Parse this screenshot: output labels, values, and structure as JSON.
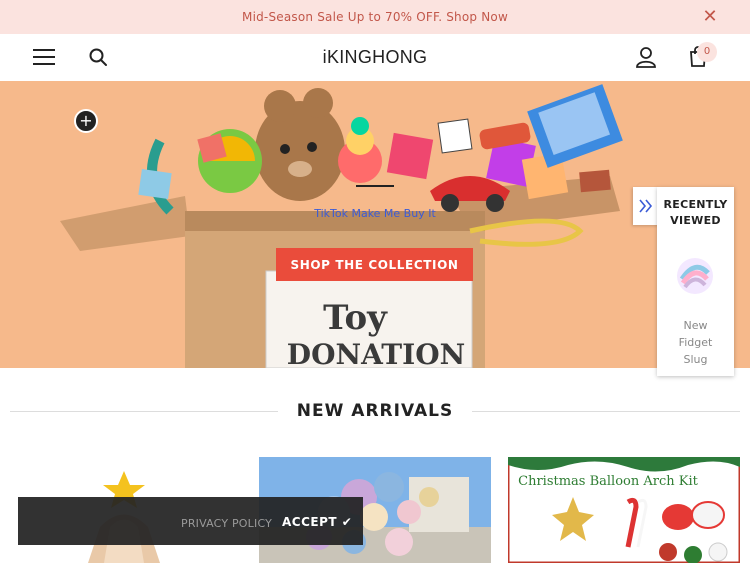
{
  "announcement": {
    "text": "Mid-Season Sale Up to 70% OFF. Shop Now",
    "close": "✕"
  },
  "header": {
    "logo": "iKINGHONG",
    "cart_count": "0"
  },
  "hero": {
    "plus": "+",
    "subtitle": "TikTok Make Me Buy It",
    "cta": "SHOP THE COLLECTION",
    "box_text_line1": "Toy",
    "box_text_line2": "DONATION"
  },
  "recently_viewed": {
    "title_line1": "RECENTLY",
    "title_line2": "VIEWED",
    "item_line1": "New",
    "item_line2": "Fidget",
    "item_line3": "Slug"
  },
  "new_arrivals": {
    "title": "NEW ARRIVALS",
    "product3_banner": "Christmas Balloon Arch Kit"
  },
  "cookie": {
    "policy": "PRIVACY POLICY",
    "accept": "ACCEPT ✔"
  },
  "colors": {
    "announce_bg": "#fbe3df",
    "accent": "#ea4c3b",
    "hero_bg": "#f6b98b",
    "subtitle": "#3b5bd6"
  }
}
